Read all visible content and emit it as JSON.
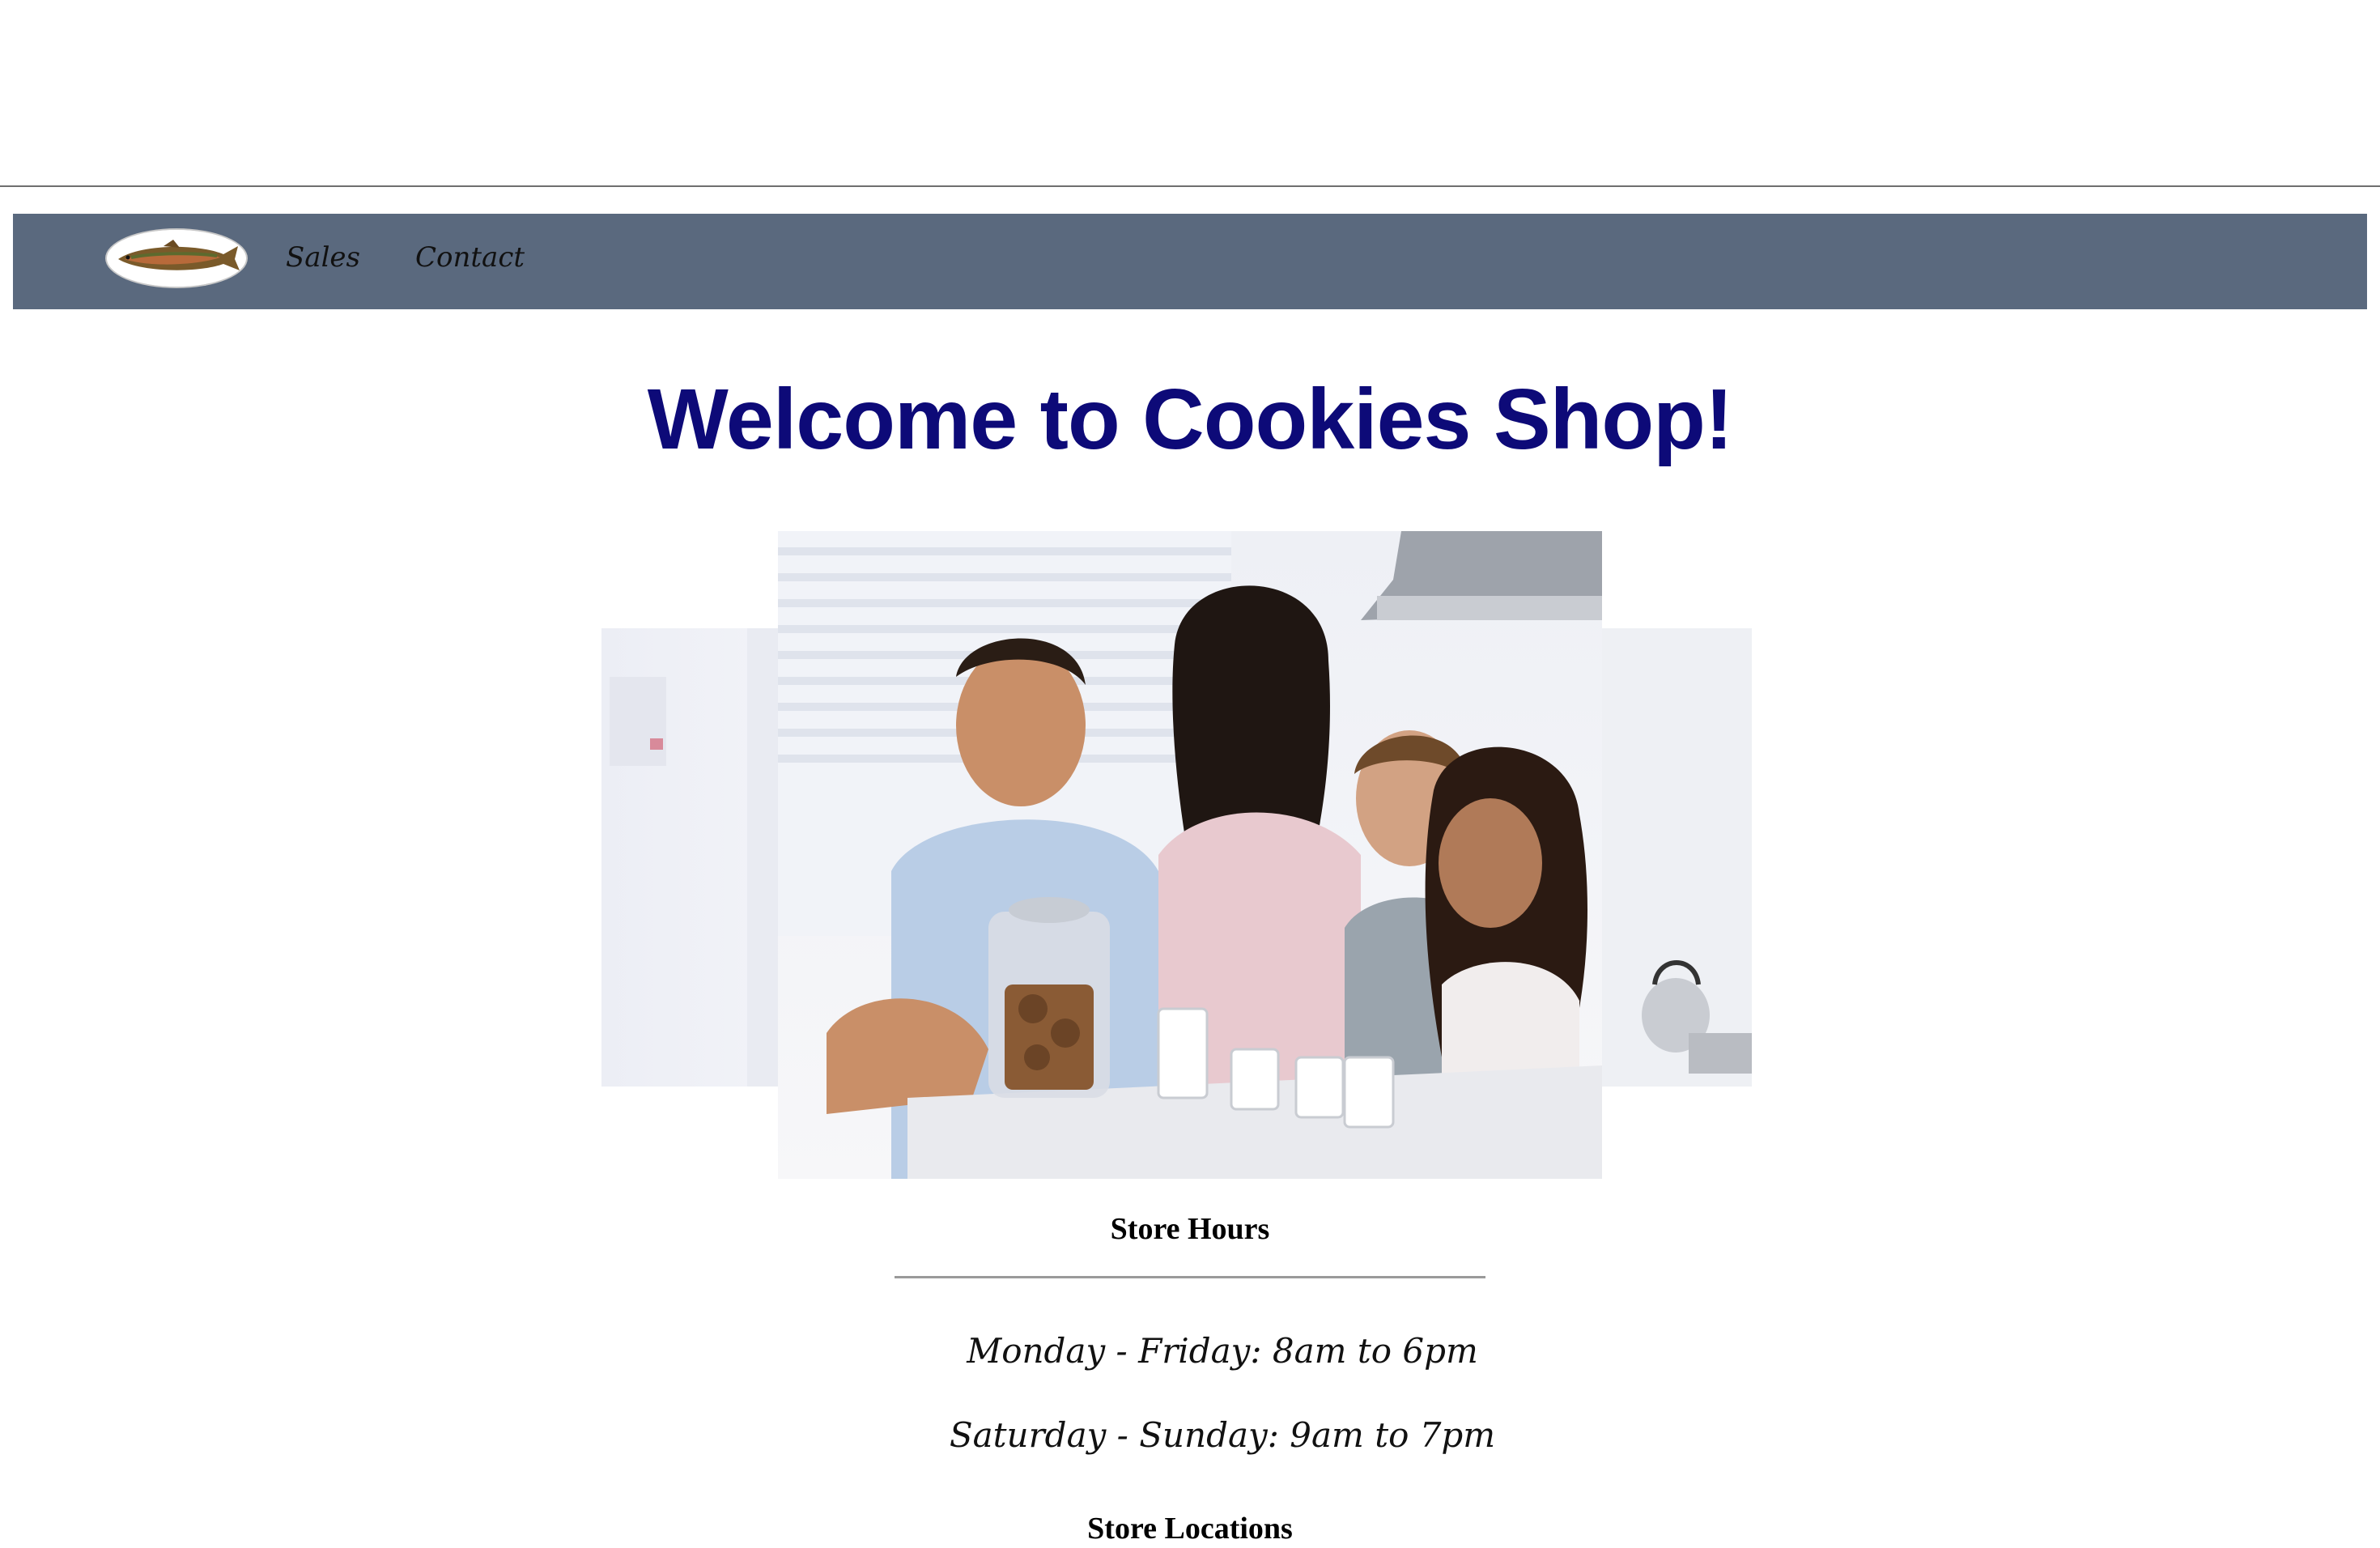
{
  "nav": {
    "logo_icon": "trout-fish-logo-icon",
    "items": [
      {
        "label": "Sales"
      },
      {
        "label": "Contact"
      }
    ],
    "background_color": "#5a697e"
  },
  "main": {
    "heading": "Welcome to Cookies Shop!",
    "heading_color": "#0d0a78",
    "hero_image_icon": "family-with-cookie-jar-photo"
  },
  "hours": {
    "title": "Store Hours",
    "lines": [
      "Monday - Friday: 8am to 6pm",
      "Saturday - Sunday: 9am to 7pm"
    ]
  },
  "locations": {
    "title": "Store Locations"
  }
}
